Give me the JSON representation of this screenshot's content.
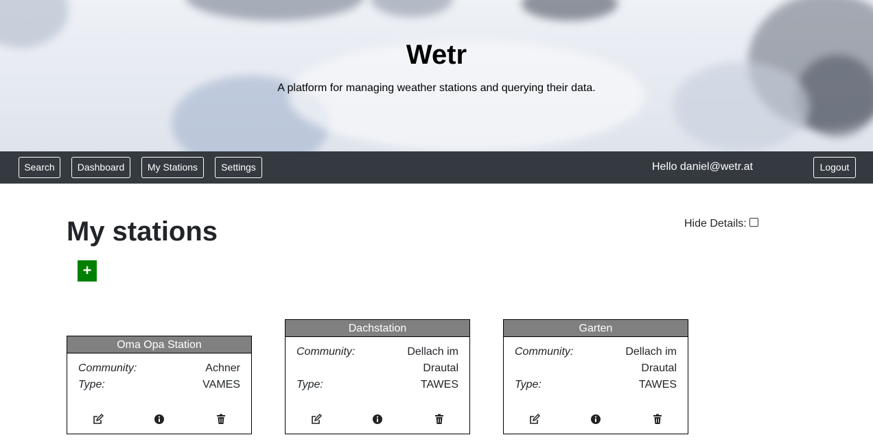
{
  "hero": {
    "title": "Wetr",
    "subtitle": "A platform for managing weather stations and querying their data."
  },
  "nav": {
    "search": "Search",
    "dashboard": "Dashboard",
    "my_stations": "My Stations",
    "settings": "Settings",
    "greeting": "Hello daniel@wetr.at",
    "logout": "Logout"
  },
  "main": {
    "title": "My stations",
    "hide_details_label": "Hide Details:",
    "hide_details_checked": false,
    "add_icon": "+"
  },
  "colors": {
    "navbar": "#343a40",
    "card_header": "#808080",
    "add_button": "#008000"
  },
  "stations": [
    {
      "name": "Oma Opa Station",
      "community_label": "Community:",
      "community_line1": "Achner",
      "community_line2": "",
      "type_label": "Type:",
      "type": "VAMES"
    },
    {
      "name": "Dachstation",
      "community_label": "Community:",
      "community_line1": "Dellach im",
      "community_line2": "Drautal",
      "type_label": "Type:",
      "type": "TAWES"
    },
    {
      "name": "Garten",
      "community_label": "Community:",
      "community_line1": "Dellach im",
      "community_line2": "Drautal",
      "type_label": "Type:",
      "type": "TAWES"
    }
  ],
  "icons": [
    "edit-icon",
    "info-icon",
    "trash-icon"
  ]
}
